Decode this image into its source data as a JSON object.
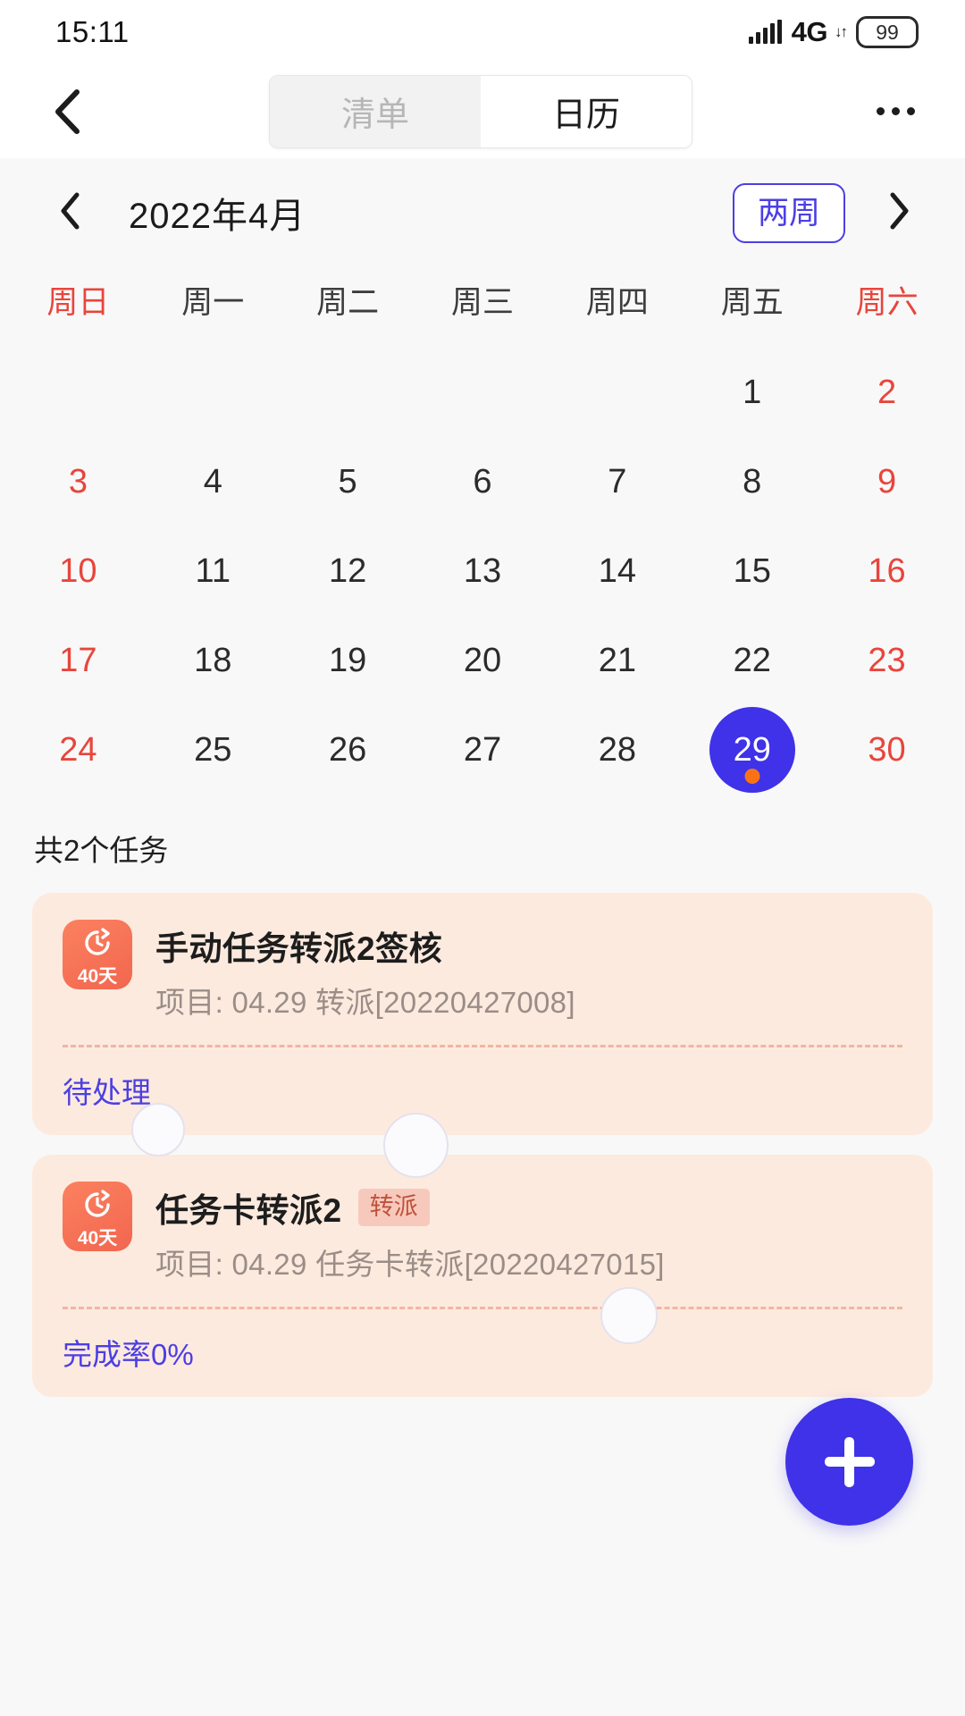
{
  "status_bar": {
    "time": "15:11",
    "network": "4G",
    "network_arrows": "↓↑",
    "battery": "99",
    "signal_icon": "signal-bars-icon"
  },
  "nav": {
    "back_icon": "chevron-left-icon",
    "more_icon": "overflow-menu-icon",
    "tabs": [
      {
        "label": "清单",
        "active": false
      },
      {
        "label": "日历",
        "active": true
      }
    ]
  },
  "calendar": {
    "prev_icon": "chevron-left-icon",
    "next_icon": "chevron-right-icon",
    "title": "2022年4月",
    "range_button": "两周",
    "weekdays": [
      {
        "label": "周日",
        "weekend": true
      },
      {
        "label": "周一",
        "weekend": false
      },
      {
        "label": "周二",
        "weekend": false
      },
      {
        "label": "周三",
        "weekend": false
      },
      {
        "label": "周四",
        "weekend": false
      },
      {
        "label": "周五",
        "weekend": false
      },
      {
        "label": "周六",
        "weekend": true
      }
    ],
    "weeks": [
      [
        {
          "day": "",
          "weekend": true,
          "empty": true
        },
        {
          "day": "",
          "weekend": false,
          "empty": true
        },
        {
          "day": "",
          "weekend": false,
          "empty": true
        },
        {
          "day": "",
          "weekend": false,
          "empty": true
        },
        {
          "day": "",
          "weekend": false,
          "empty": true
        },
        {
          "day": "1",
          "weekend": false,
          "empty": false
        },
        {
          "day": "2",
          "weekend": true,
          "empty": false
        }
      ],
      [
        {
          "day": "3",
          "weekend": true,
          "empty": false
        },
        {
          "day": "4",
          "weekend": false,
          "empty": false
        },
        {
          "day": "5",
          "weekend": false,
          "empty": false
        },
        {
          "day": "6",
          "weekend": false,
          "empty": false
        },
        {
          "day": "7",
          "weekend": false,
          "empty": false
        },
        {
          "day": "8",
          "weekend": false,
          "empty": false
        },
        {
          "day": "9",
          "weekend": true,
          "empty": false
        }
      ],
      [
        {
          "day": "10",
          "weekend": true,
          "empty": false
        },
        {
          "day": "11",
          "weekend": false,
          "empty": false
        },
        {
          "day": "12",
          "weekend": false,
          "empty": false
        },
        {
          "day": "13",
          "weekend": false,
          "empty": false
        },
        {
          "day": "14",
          "weekend": false,
          "empty": false
        },
        {
          "day": "15",
          "weekend": false,
          "empty": false
        },
        {
          "day": "16",
          "weekend": true,
          "empty": false
        }
      ],
      [
        {
          "day": "17",
          "weekend": true,
          "empty": false
        },
        {
          "day": "18",
          "weekend": false,
          "empty": false
        },
        {
          "day": "19",
          "weekend": false,
          "empty": false
        },
        {
          "day": "20",
          "weekend": false,
          "empty": false
        },
        {
          "day": "21",
          "weekend": false,
          "empty": false
        },
        {
          "day": "22",
          "weekend": false,
          "empty": false
        },
        {
          "day": "23",
          "weekend": true,
          "empty": false
        }
      ],
      [
        {
          "day": "24",
          "weekend": true,
          "empty": false
        },
        {
          "day": "25",
          "weekend": false,
          "empty": false
        },
        {
          "day": "26",
          "weekend": false,
          "empty": false
        },
        {
          "day": "27",
          "weekend": false,
          "empty": false
        },
        {
          "day": "28",
          "weekend": false,
          "empty": false
        },
        {
          "day": "29",
          "weekend": false,
          "empty": false,
          "selected": true,
          "has_event": true
        },
        {
          "day": "30",
          "weekend": true,
          "empty": false
        }
      ]
    ]
  },
  "tasks": {
    "count_label": "共2个任务",
    "items": [
      {
        "icon_name": "clock-refresh-icon",
        "icon_days": "40天",
        "title": "手动任务转派2签核",
        "badge": "",
        "subtitle": "项目: 04.29 转派[20220427008]",
        "status": "待处理"
      },
      {
        "icon_name": "clock-refresh-icon",
        "icon_days": "40天",
        "title": "任务卡转派2",
        "badge": "转派",
        "subtitle": "项目: 04.29 任务卡转派[20220427015]",
        "status": "完成率0%"
      }
    ]
  },
  "fab": {
    "icon": "plus-icon",
    "color": "#3f32e8"
  },
  "colors": {
    "accent": "#3f32e8",
    "accent_text": "#4b3fe4",
    "weekend": "#e8453c",
    "card_bg": "#fdeade",
    "card_divider": "#f1b5a3",
    "badge_bg": "#f7c9bd",
    "badge_text": "#c0513a",
    "event_dot": "#f97316",
    "page_bg": "#f8f8f8"
  }
}
